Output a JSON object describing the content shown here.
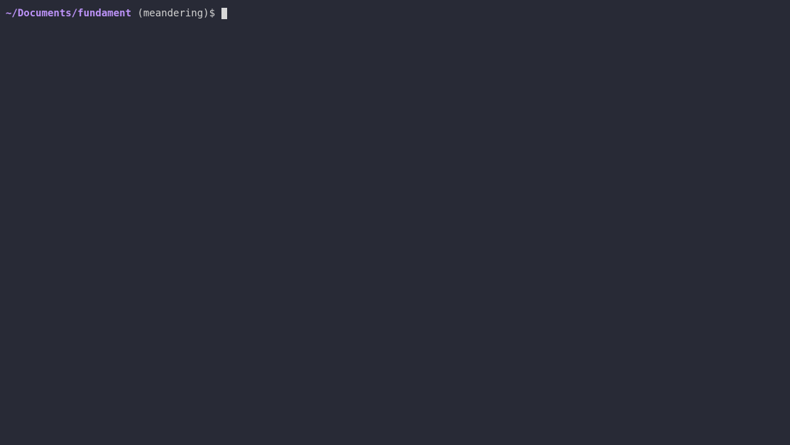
{
  "prompt": {
    "path": "~/Documents/fundament",
    "branch_open": " (",
    "branch_name": "meandering",
    "branch_close": ")",
    "symbol": "$ "
  }
}
